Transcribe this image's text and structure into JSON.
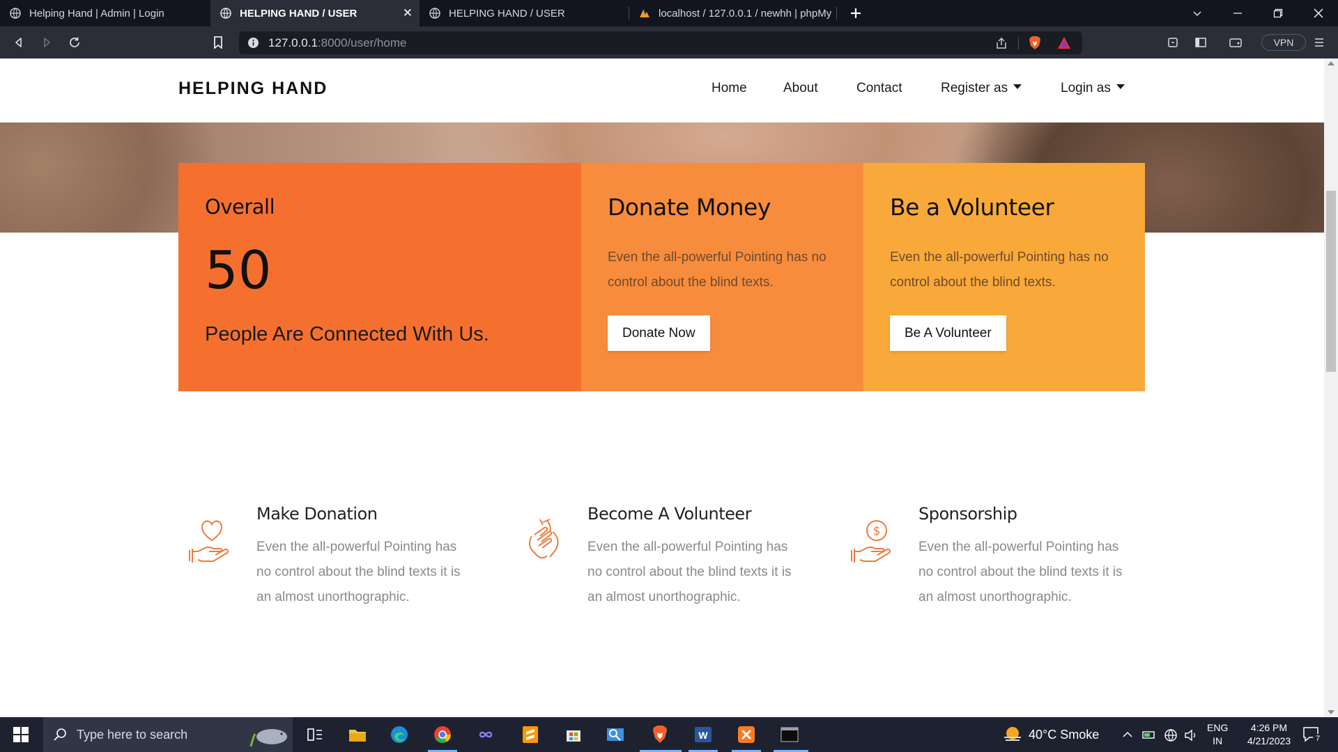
{
  "browser": {
    "tabs": [
      {
        "title": "Helping Hand | Admin | Login",
        "active": false
      },
      {
        "title": "HELPING HAND / USER",
        "active": true
      },
      {
        "title": "HELPING HAND / USER",
        "active": false
      },
      {
        "title": "localhost / 127.0.0.1 / newhh | phpMy",
        "active": false
      }
    ],
    "url": {
      "host": "127.0.0.1",
      "rest": ":8000/user/home"
    },
    "vpn_label": "VPN"
  },
  "site": {
    "brand": "HELPING HAND",
    "nav": {
      "home": "Home",
      "about": "About",
      "contact": "Contact",
      "register": "Register as",
      "login": "Login as"
    }
  },
  "cards": {
    "overall": {
      "label": "Overall",
      "count": "50",
      "caption": "People Are Connected With Us."
    },
    "donate": {
      "title": "Donate Money",
      "text": "Even the all-powerful Pointing has no control about the blind texts.",
      "button": "Donate Now"
    },
    "volunteer": {
      "title": "Be a Volunteer",
      "text": "Even the all-powerful Pointing has no control about the blind texts.",
      "button": "Be A Volunteer"
    }
  },
  "services": [
    {
      "title": "Make Donation",
      "text": "Even the all-powerful Pointing has no control about the blind texts it is an almost unorthographic.",
      "icon": "heart-hand-icon"
    },
    {
      "title": "Become A Volunteer",
      "text": "Even the all-powerful Pointing has no control about the blind texts it is an almost unorthographic.",
      "icon": "helping-hands-icon"
    },
    {
      "title": "Sponsorship",
      "text": "Even the all-powerful Pointing has no control about the blind texts it is an almost unorthographic.",
      "icon": "dollar-hand-icon"
    }
  ],
  "colors": {
    "overall_card": "#f5702f",
    "donate_card": "#f88c3d",
    "volunteer_card": "#f9a93a",
    "icon_accent": "#f07a3a"
  },
  "taskbar": {
    "search_placeholder": "Type here to search",
    "weather": "40°C  Smoke",
    "lang_line1": "ENG",
    "lang_line2": "IN",
    "time": "4:26 PM",
    "date": "4/21/2023",
    "notification_count": "7"
  }
}
